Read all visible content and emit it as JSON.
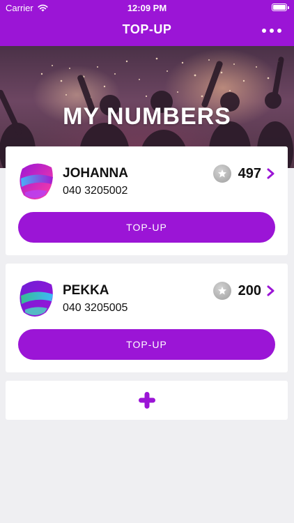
{
  "status_bar": {
    "carrier": "Carrier",
    "time": "12:09 PM"
  },
  "nav": {
    "title": "TOP-UP",
    "more_icon": "more-horizontal-icon"
  },
  "hero": {
    "title": "MY NUMBERS"
  },
  "numbers": [
    {
      "name": "JOHANNA",
      "phone": "040 3205002",
      "points": "497",
      "button": "TOP-UP"
    },
    {
      "name": "PEKKA",
      "phone": "040 3205005",
      "points": "200",
      "button": "TOP-UP"
    }
  ],
  "add_button": {
    "icon": "plus-icon"
  },
  "colors": {
    "primary": "#9b15d6",
    "background": "#efeff2",
    "card": "#ffffff",
    "points_icon": "#a8a8a8"
  }
}
